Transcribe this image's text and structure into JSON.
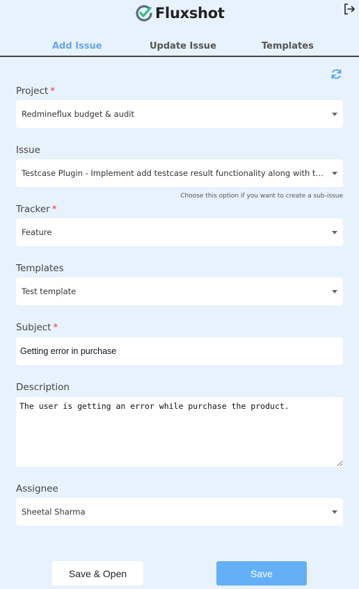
{
  "app": {
    "title": "Fluxshot"
  },
  "icons": {
    "logo": "check-circle-logo",
    "logout": "logout-icon",
    "refresh": "refresh-icon",
    "dropdown": "caret-down-icon"
  },
  "colors": {
    "accent": "#6aa5e8",
    "required": "#e23b3b",
    "save_button": "#64b0f6",
    "background": "#e8f2fc"
  },
  "tabs": [
    {
      "label": "Add Issue",
      "active": true
    },
    {
      "label": "Update Issue",
      "active": false
    },
    {
      "label": "Templates",
      "active": false
    }
  ],
  "form": {
    "required_mark": "*",
    "project": {
      "label": "Project",
      "value": "Redmineflux budget & audit"
    },
    "issue": {
      "label": "Issue",
      "value": "Testcase Plugin - Implement add testcase result functionality along with the attachment",
      "hint": "Choose this option if you want to create a sub-issue"
    },
    "tracker": {
      "label": "Tracker",
      "value": "Feature"
    },
    "templates": {
      "label": "Templates",
      "value": "Test template"
    },
    "subject": {
      "label": "Subject",
      "value": "Getting error in purchase"
    },
    "description": {
      "label": "Description",
      "value": "The user is getting an error while purchase the product."
    },
    "assignee": {
      "label": "Assignee",
      "value": "Sheetal Sharma"
    }
  },
  "buttons": {
    "save_open": "Save & Open",
    "save": "Save"
  }
}
